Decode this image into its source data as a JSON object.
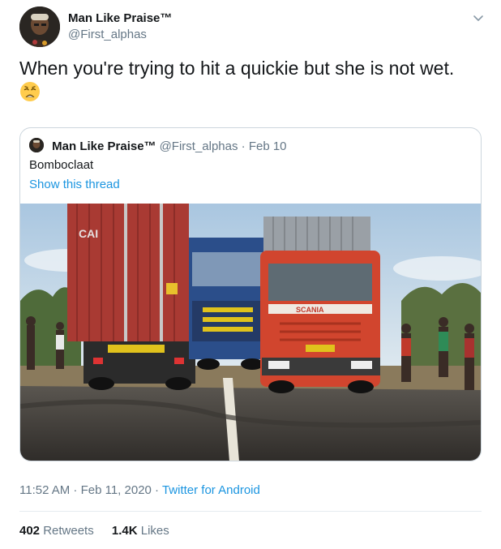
{
  "tweet": {
    "display_name": "Man Like Praise™",
    "handle": "@First_alphas",
    "text": "When you're trying to hit a quickie but she is not wet.",
    "emoji": "weary-face"
  },
  "quote": {
    "display_name": "Man Like Praise™",
    "meta": "@First_alphas · Feb 10",
    "text": "Bomboclaat",
    "show_thread": "Show this thread",
    "photo_text": {
      "container_logo": "CAI",
      "truck_brand": "SCANIA"
    }
  },
  "footer": {
    "timestamp": "11:52 AM · Feb 11, 2020 · ",
    "source": "Twitter for Android",
    "retweets_count": "402",
    "retweets_label": " Retweets",
    "likes_count": "1.4K",
    "likes_label": " Likes"
  },
  "colors": {
    "link": "#1b95e0",
    "muted": "#657786",
    "text": "#14171a",
    "border": "#ccd6dd"
  }
}
